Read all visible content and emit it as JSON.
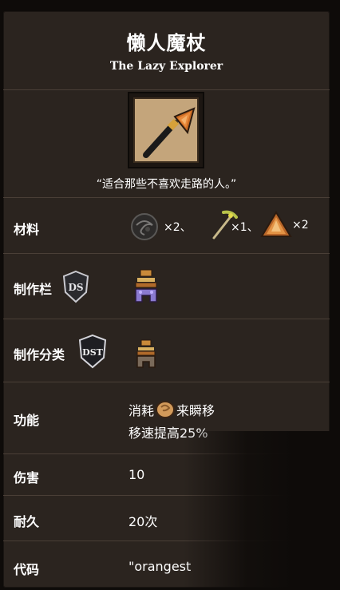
{
  "header": {
    "title": "懒人魔杖",
    "subtitle": "The Lazy Explorer"
  },
  "item": {
    "icon": "lazy-explorer-staff-icon",
    "quote": "“适合那些不喜欢走路的人。”"
  },
  "rows": {
    "materials": {
      "label": "材料",
      "items": [
        {
          "icon": "nightmare-fuel-icon",
          "count": "×2、"
        },
        {
          "icon": "pickaxe-icon",
          "count": "×1、"
        },
        {
          "icon": "orange-gem-icon",
          "count": "×2"
        }
      ]
    },
    "craft_tab": {
      "label": "制作栏",
      "badge": "DS",
      "station_icon": "ancient-pseudoscience-station-icon"
    },
    "craft_category": {
      "label": "制作分类",
      "badge": "DST",
      "station_icon": "ancient-altar-icon"
    },
    "function": {
      "label": "功能",
      "line1_before": "消耗",
      "line1_icon": "hunger-stomach-icon",
      "line1_after": "来瞬移",
      "line2": "移速提高25%"
    },
    "damage": {
      "label": "伤害",
      "value": "10"
    },
    "durability": {
      "label": "耐久",
      "value": "20次"
    },
    "code": {
      "label": "代码",
      "value": "\"orangest"
    }
  },
  "colors": {
    "background": "#0e0b09",
    "panel": "#2b241f",
    "divider": "#4a3f37",
    "text": "#ffffff"
  }
}
